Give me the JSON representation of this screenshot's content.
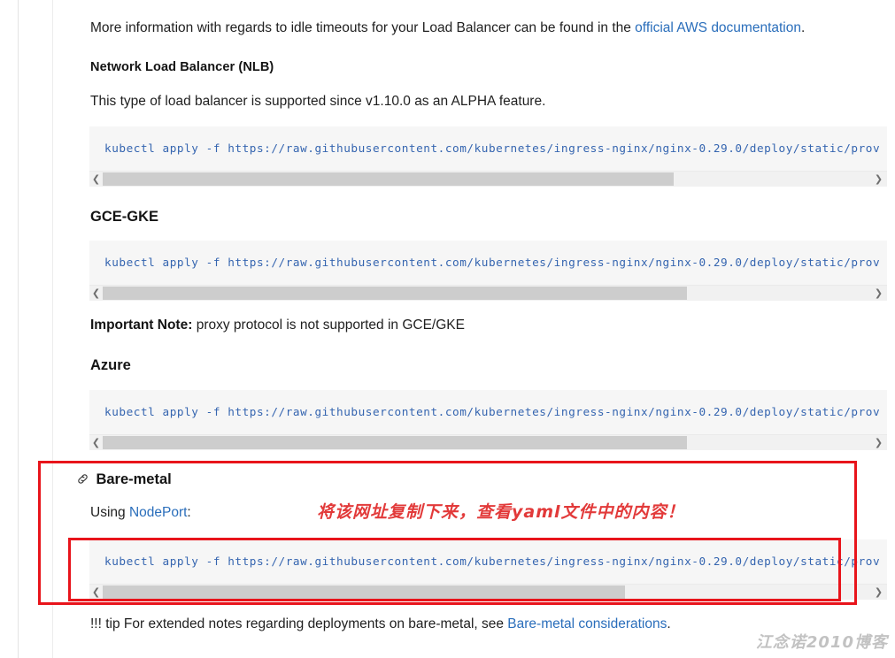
{
  "document": {
    "intro": {
      "text_before": "More information with regards to idle timeouts for your Load Balancer can be found in the ",
      "link_label": "official AWS documentation",
      "text_after": "."
    },
    "sections": [
      {
        "heading": "Network Load Balancer (NLB)",
        "body": "This type of load balancer is supported since v1.10.0 as an ALPHA feature.",
        "code": "kubectl apply -f https://raw.githubusercontent.com/kubernetes/ingress-nginx/nginx-0.29.0/deploy/static/prov"
      },
      {
        "heading": "GCE-GKE",
        "code": "kubectl apply -f https://raw.githubusercontent.com/kubernetes/ingress-nginx/nginx-0.29.0/deploy/static/prov"
      },
      {
        "heading": "Azure",
        "code": "kubectl apply -f https://raw.githubusercontent.com/kubernetes/ingress-nginx/nginx-0.29.0/deploy/static/prov"
      }
    ],
    "important_note": {
      "label": "Important Note:",
      "text": " proxy protocol is not supported in GCE/GKE"
    },
    "bare_metal": {
      "heading": "Bare-metal",
      "using_prefix": "Using ",
      "using_link": "NodePort",
      "using_suffix": ":",
      "code": "kubectl apply -f https://raw.githubusercontent.com/kubernetes/ingress-nginx/nginx-0.29.0/deploy/static/prov"
    },
    "tip": {
      "text_before": "!!! tip For extended notes regarding deployments on bare-metal, see ",
      "link_label": "Bare-metal considerations",
      "text_after": "."
    },
    "annotation_cn": "将该网址复制下来，查看yaml文件中的内容！",
    "watermark": "江念诺2010博客"
  },
  "colors": {
    "link": "#2a6ebb",
    "code_text": "#3565b0",
    "code_bg": "#f6f6f6",
    "highlight_red": "#e8141b",
    "annotation_red": "#e23a3a"
  }
}
